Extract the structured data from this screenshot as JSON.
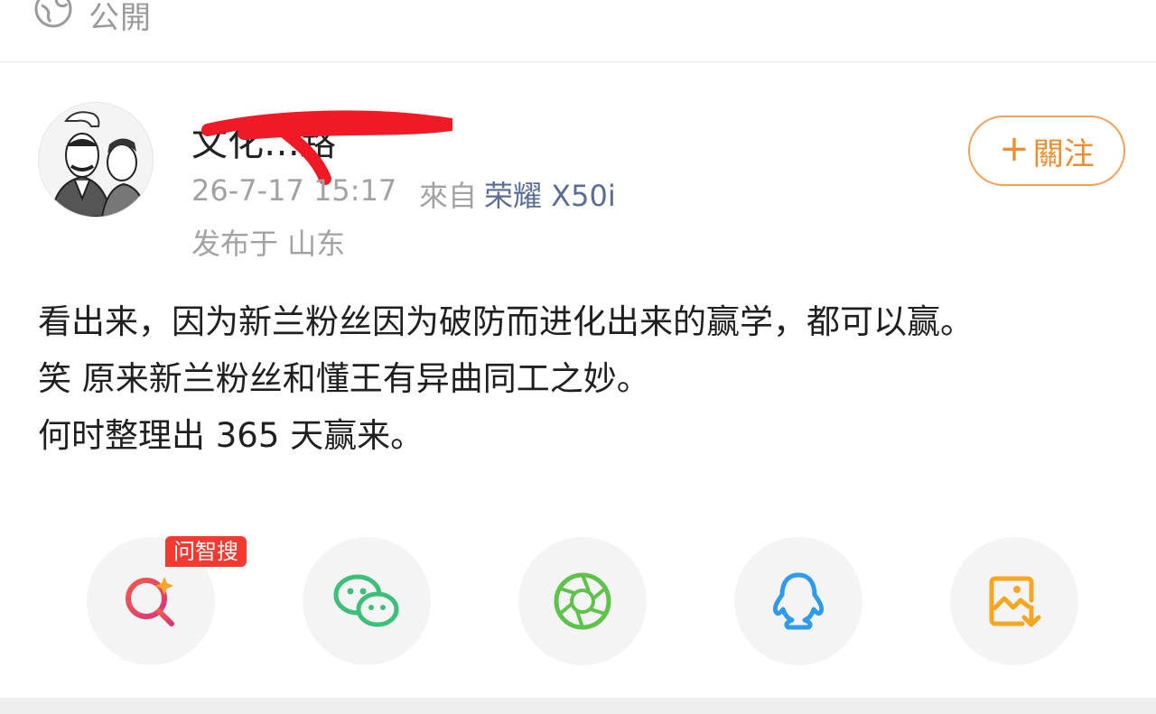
{
  "header": {
    "visibility_icon": "globe-icon",
    "visibility_label": "公開"
  },
  "post": {
    "author": {
      "name": "文化…路",
      "avatar": "avatar-illustration"
    },
    "time": "26-7-17 15:17",
    "source_prefix": "來自",
    "device": "荣耀 X50i",
    "location": "发布于 山东",
    "follow_label": "關注",
    "content_lines": [
      "看出来，因为新兰粉丝因为破防而进化出来的赢学，都可以赢。",
      "笑 原来新兰粉丝和懂王有异曲同工之妙。",
      "何时整理出 365 天赢来。"
    ]
  },
  "share": {
    "badge": "问智搜",
    "buttons": [
      {
        "icon": "ai-search-icon",
        "color": "#e8485a"
      },
      {
        "icon": "wechat-icon",
        "color": "#3dbf7a"
      },
      {
        "icon": "moments-icon",
        "color": "#5ec24b"
      },
      {
        "icon": "qq-icon",
        "color": "#2f9bef"
      },
      {
        "icon": "save-image-icon",
        "color": "#f5a623"
      }
    ]
  },
  "colors": {
    "accent": "#ee8c2f",
    "link": "#5a6d95",
    "meta": "#a2a2a2",
    "badge": "#f23a30"
  }
}
